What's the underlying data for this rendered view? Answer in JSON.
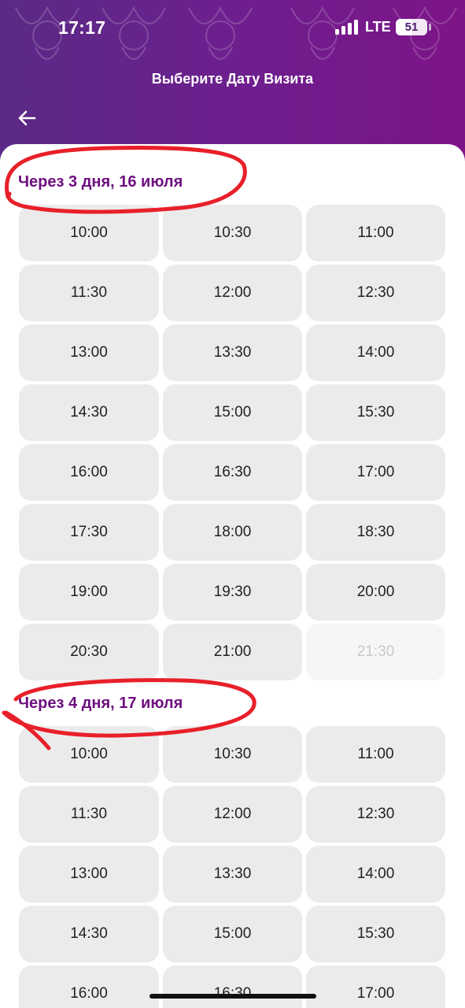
{
  "status_bar": {
    "time": "17:17",
    "network": "LTE",
    "battery": "51",
    "battery_level": 0.51
  },
  "header": {
    "title": "Выберите Дату Визита",
    "back_icon": "arrow-left-icon"
  },
  "colors": {
    "header_start": "#5a2a86",
    "header_end": "#7d1488",
    "accent": "#6e1080",
    "annotation": "#e8202a"
  },
  "days": [
    {
      "title": "Через 3 дня, 16 июля",
      "slots": [
        {
          "time": "10:00",
          "available": true
        },
        {
          "time": "10:30",
          "available": true
        },
        {
          "time": "11:00",
          "available": true
        },
        {
          "time": "11:30",
          "available": true
        },
        {
          "time": "12:00",
          "available": true
        },
        {
          "time": "12:30",
          "available": true
        },
        {
          "time": "13:00",
          "available": true
        },
        {
          "time": "13:30",
          "available": true
        },
        {
          "time": "14:00",
          "available": true
        },
        {
          "time": "14:30",
          "available": true
        },
        {
          "time": "15:00",
          "available": true
        },
        {
          "time": "15:30",
          "available": true
        },
        {
          "time": "16:00",
          "available": true
        },
        {
          "time": "16:30",
          "available": true
        },
        {
          "time": "17:00",
          "available": true
        },
        {
          "time": "17:30",
          "available": true
        },
        {
          "time": "18:00",
          "available": true
        },
        {
          "time": "18:30",
          "available": true
        },
        {
          "time": "19:00",
          "available": true
        },
        {
          "time": "19:30",
          "available": true
        },
        {
          "time": "20:00",
          "available": true
        },
        {
          "time": "20:30",
          "available": true
        },
        {
          "time": "21:00",
          "available": true
        },
        {
          "time": "21:30",
          "available": false
        }
      ]
    },
    {
      "title": "Через 4 дня, 17 июля",
      "slots": [
        {
          "time": "10:00",
          "available": true
        },
        {
          "time": "10:30",
          "available": true
        },
        {
          "time": "11:00",
          "available": true
        },
        {
          "time": "11:30",
          "available": true
        },
        {
          "time": "12:00",
          "available": true
        },
        {
          "time": "12:30",
          "available": true
        },
        {
          "time": "13:00",
          "available": true
        },
        {
          "time": "13:30",
          "available": true
        },
        {
          "time": "14:00",
          "available": true
        },
        {
          "time": "14:30",
          "available": true
        },
        {
          "time": "15:00",
          "available": true
        },
        {
          "time": "15:30",
          "available": true
        },
        {
          "time": "16:00",
          "available": true
        },
        {
          "time": "16:30",
          "available": true
        },
        {
          "time": "17:00",
          "available": true
        }
      ]
    }
  ]
}
